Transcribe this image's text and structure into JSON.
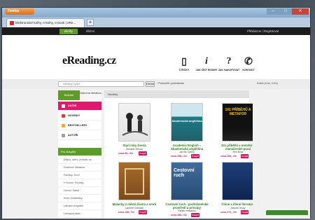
{
  "browser": {
    "menu_label": "Firefox",
    "tab_title": "Elektronické knihy, e-knihy, e-book | eRe...",
    "new_tab": "+",
    "win_controls": {
      "minimize": "–",
      "maximize": "□",
      "close": "✕"
    }
  },
  "topnav": {
    "items": [
      "eknihy",
      "tištěné"
    ],
    "login": "Přihlásit se  |  Registrovat"
  },
  "header": {
    "logo": "eReading.cz",
    "icons": [
      {
        "glyph": "▯",
        "label": "ČTEČKY",
        "icon": "ereader-icon"
      },
      {
        "glyph": "i",
        "label": "JAK ČÍST EKNIHY",
        "icon": "info-icon"
      },
      {
        "glyph": "?",
        "label": "JAK NAKUPOVAT",
        "icon": "question-icon"
      },
      {
        "glyph": "✆",
        "label": "KONTAKT",
        "icon": "phone-icon"
      }
    ]
  },
  "search": {
    "placeholder": "Hledaný výraz",
    "button": "Hledat",
    "advanced": "› Pokročilé vyhledávání",
    "cart": "Košík (0 ks, 0 Kč)"
  },
  "sidebar": {
    "tabs": [
      "Beletrie",
      "Odborná literatura"
    ],
    "items": [
      {
        "label": "AKČNÍ",
        "color": "#ffffff"
      },
      {
        "label": "NOVINKY",
        "color": "#e53935"
      },
      {
        "label": "BESTSELLERY",
        "color": "#f9a825"
      },
      {
        "label": "AUTOŘI",
        "color": "#9e9e9e"
      }
    ],
    "pro_label": "Pro dospělé",
    "genres": [
      "Dějiny, cítení, příroda, zp.",
      "Duchovní literatura",
      "Fantasy, Sci-fi",
      "» Humor, Povídky",
      "Humor, Satira",
      "Krimi, Detektivky",
      "Literární biografie",
      "Literatura faktu",
      "Poezie",
      "Povídky a novely",
      "» Romány",
      "Ságy"
    ]
  },
  "content": {
    "heading": "Novinky",
    "buy_label": "Koupit",
    "books": [
      {
        "title": "Styri roky života",
        "author": "Miroslav Strnad",
        "price": "cena 96,- Kč",
        "cover_text": ""
      },
      {
        "title": "Academic English – Akademická angličtina",
        "author": "Jan Mc Carthy",
        "price": "cena 298,- Kč",
        "cover_text": "Akademická angličtina"
      },
      {
        "title": "101 příběhů a metafor v manažerské praxi",
        "author": "Petr Boss",
        "price": "cena 209,- Kč",
        "cover_text": "101 PŘÍBĚHŮ A METAFOR"
      },
      {
        "title": "Malachy z města života a smrti",
        "author": "Lambert Christian",
        "price": "cena 149,- Kč",
        "cover_text": ""
      },
      {
        "title": "Cestovní ruch - podnikatelská prostředí a principy",
        "author": "Radek Hrabánek",
        "price": "cena 256,- Kč",
        "cover_text": "Cestovní ruch"
      },
      {
        "title": "Čtíme a čtené literatury",
        "author": "Zdeněk Hrubý",
        "price": "cena 271,- Kč",
        "cover_text": ""
      }
    ]
  }
}
